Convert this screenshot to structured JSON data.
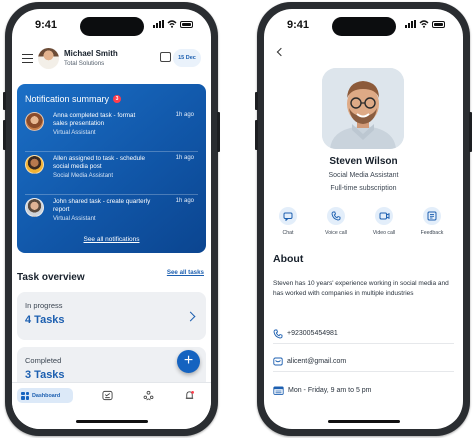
{
  "left_screen": {
    "status_time": "9:41",
    "header": {
      "user_name": "Michael Smith",
      "company": "Total Solutions",
      "date_badge": "15 Dec"
    },
    "notifications": {
      "title": "Notification summary",
      "count": "3",
      "items": [
        {
          "text": "Anna completed task - format sales presentation",
          "who": "Virtual Assistant",
          "ago": "1h ago"
        },
        {
          "text": "Allen assigned to task - schedule social media post",
          "who": "Social Media Assistant",
          "ago": "1h ago"
        },
        {
          "text": "John shared task - create quarterly report",
          "who": "Virtual Assistant",
          "ago": "1h ago"
        }
      ],
      "see_all": "See all notifications"
    },
    "task_overview": {
      "title": "Task overview",
      "see_all": "See all tasks"
    },
    "cards": [
      {
        "label": "In progress",
        "value": "4 Tasks"
      },
      {
        "label": "Completed",
        "value": "3 Tasks"
      }
    ],
    "fab_label": "+",
    "tabbar": {
      "dashboard": "Dashboard"
    },
    "colors": {
      "primary": "#1563c0",
      "badge": "#ff3d4c"
    }
  },
  "right_screen": {
    "status_time": "9:41",
    "profile": {
      "name": "Steven Wilson",
      "role": "Social Media Assistant",
      "subscription": "Full-time subscription"
    },
    "actions": [
      {
        "label": "Chat",
        "icon": "chat-icon"
      },
      {
        "label": "Voice call",
        "icon": "phone-icon"
      },
      {
        "label": "Video call",
        "icon": "video-icon"
      },
      {
        "label": "Feedback",
        "icon": "feedback-icon"
      }
    ],
    "about": {
      "title": "About",
      "text": "Steven has 10 years' experience working in social media and has worked with companies in multiple industries"
    },
    "contacts": {
      "phone": "+923005454981",
      "email": "alicent@gmail.com",
      "hours": "Mon - Friday, 9 am to 5 pm"
    }
  }
}
